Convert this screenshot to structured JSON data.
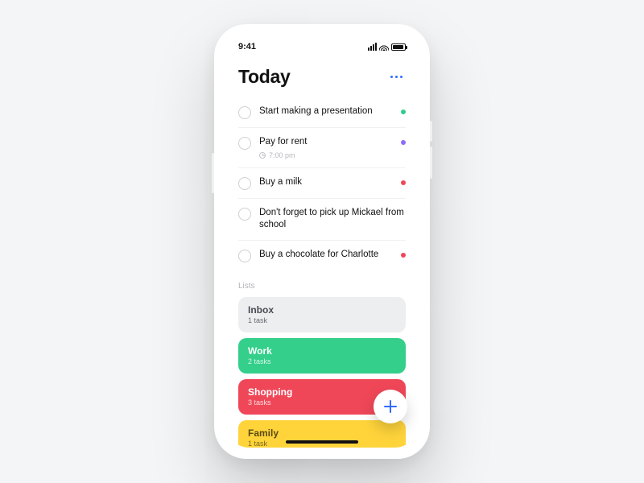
{
  "statusbar": {
    "time": "9:41"
  },
  "header": {
    "title": "Today"
  },
  "tasks": [
    {
      "title": "Start making a presentation",
      "time": null,
      "tag_color": "#2ecc8f"
    },
    {
      "title": "Pay for rent",
      "time": "7:00 pm",
      "tag_color": "#8e6bff"
    },
    {
      "title": "Buy a milk",
      "time": null,
      "tag_color": "#ef4758"
    },
    {
      "title": "Don't forget to pick up Mickael from school",
      "time": null,
      "tag_color": null
    },
    {
      "title": "Buy a chocolate for Charlotte",
      "time": null,
      "tag_color": "#ef4758"
    }
  ],
  "lists_label": "Lists",
  "lists": [
    {
      "name": "Inbox",
      "count": "1 task",
      "bg": "#eceef0",
      "fg": "#4a4a52"
    },
    {
      "name": "Work",
      "count": "2 tasks",
      "bg": "#33cf8b",
      "fg": "#ffffff"
    },
    {
      "name": "Shopping",
      "count": "3 tasks",
      "bg": "#ef4758",
      "fg": "#ffffff"
    },
    {
      "name": "Family",
      "count": "1 task",
      "bg": "#ffd43b",
      "fg": "#5a4a10"
    }
  ]
}
